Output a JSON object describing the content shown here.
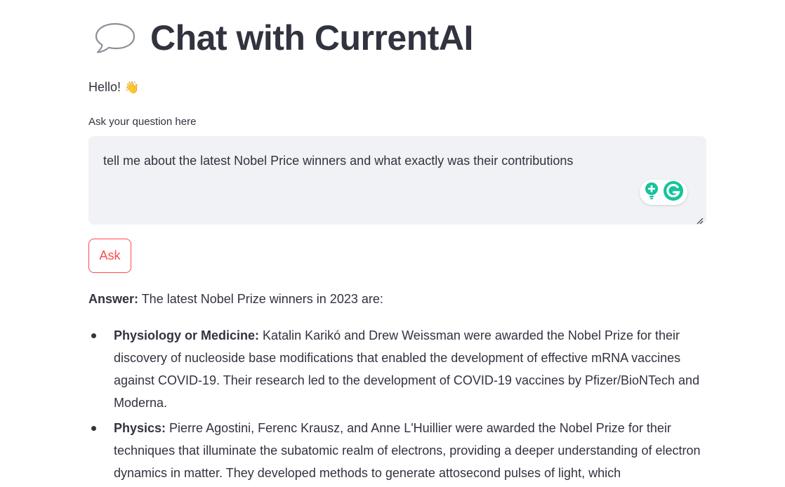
{
  "app": {
    "title": "Chat with CurrentAI",
    "title_icon": "speech-balloon-icon"
  },
  "greeting": {
    "text": "Hello!",
    "emoji": "👋"
  },
  "question": {
    "label": "Ask your question here",
    "value": "tell me about the latest Nobel Price winners and what exactly was their contributions"
  },
  "ask_button": {
    "label": "Ask",
    "color": "#ff4b4b"
  },
  "answer": {
    "prefix": "Answer:",
    "intro": " The latest Nobel Prize winners in 2023 are:",
    "items": [
      {
        "category": "Physiology or Medicine:",
        "text": " Katalin Karikó and Drew Weissman were awarded the Nobel Prize for their discovery of nucleoside base modifications that enabled the development of effective mRNA vaccines against COVID-19. Their research led to the development of COVID-19 vaccines by Pfizer/BioNTech and Moderna."
      },
      {
        "category": "Physics:",
        "text": " Pierre Agostini, Ferenc Krausz, and Anne L'Huillier were awarded the Nobel Prize for their techniques that illuminate the subatomic realm of electrons, providing a deeper understanding of electron dynamics in matter. They developed methods to generate attosecond pulses of light, which"
      }
    ]
  },
  "extension": {
    "grammarly_color": "#15c39a",
    "icons": [
      "lightbulb-icon",
      "grammarly-icon"
    ]
  },
  "colors": {
    "text": "#31333f",
    "input_bg": "#f0f2f6",
    "accent": "#ff4b4b"
  }
}
